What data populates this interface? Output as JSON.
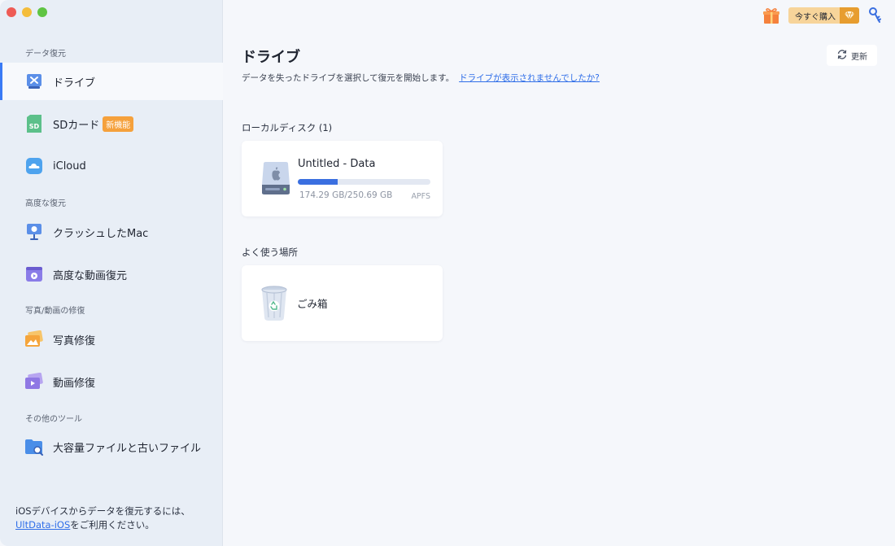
{
  "sidebar": {
    "sections": {
      "data_recovery": "データ復元",
      "advanced_recovery": "高度な復元",
      "repair": "写真/動画の修復",
      "other_tools": "その他のツール"
    },
    "items": [
      {
        "label": "ドライブ",
        "icon": "drive-icon"
      },
      {
        "label": "SDカード",
        "icon": "sd-card-icon",
        "badge": "新機能"
      },
      {
        "label": "iCloud",
        "icon": "icloud-icon"
      },
      {
        "label": "クラッシュしたMac",
        "icon": "crashed-mac-icon"
      },
      {
        "label": "高度な動画復元",
        "icon": "video-recovery-icon"
      },
      {
        "label": "写真修復",
        "icon": "photo-repair-icon"
      },
      {
        "label": "動画修復",
        "icon": "video-repair-icon"
      },
      {
        "label": "大容量ファイルと古いファイル",
        "icon": "large-files-icon"
      }
    ],
    "footer": {
      "text1": "iOSデバイスからデータを復元するには、",
      "link": "UltData-iOS",
      "text2": "をご利用ください。"
    }
  },
  "header": {
    "buy_label": "今すぐ購入"
  },
  "main": {
    "title": "ドライブ",
    "subtitle": "データを失ったドライブを選択して復元を開始します。",
    "help_link": "ドライブが表示されませんでしたか?",
    "refresh_label": "更新",
    "local_disk_title": "ローカルディスク (1)",
    "favorites_title": "よく使う場所",
    "disk": {
      "name": "Untitled - Data",
      "size": "174.29 GB/250.69 GB",
      "fs": "APFS",
      "used_fraction": 0.3
    },
    "trash": {
      "label": "ごみ箱"
    }
  },
  "colors": {
    "accent": "#3a7bf5",
    "link": "#2f6ee8",
    "badge": "#f5a13c",
    "buy": "#f7d49a"
  }
}
